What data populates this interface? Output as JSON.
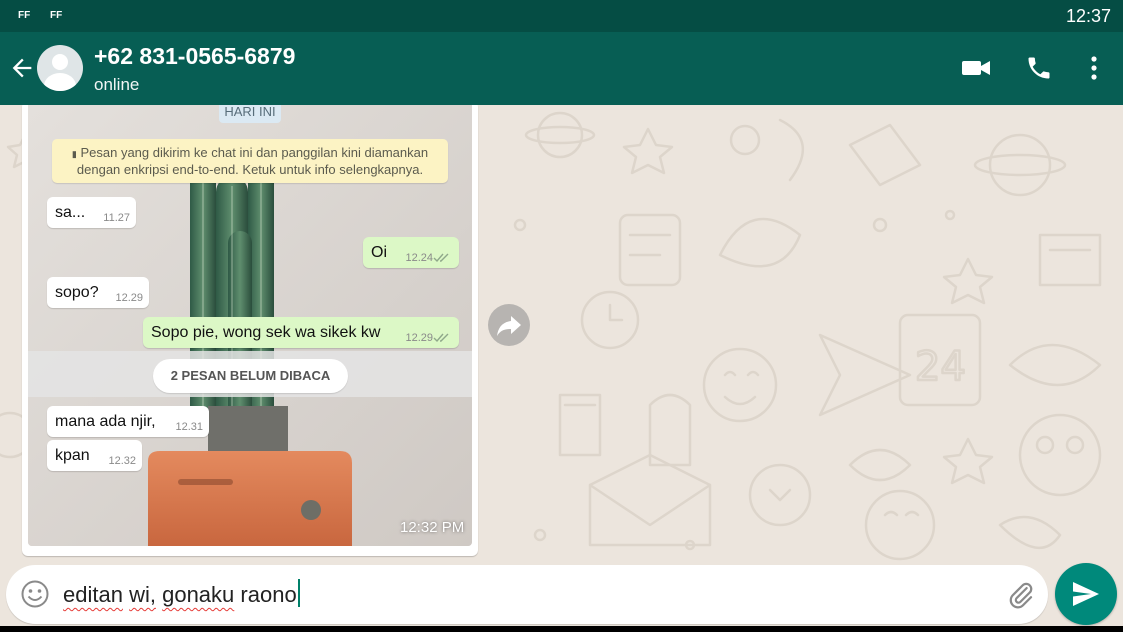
{
  "status_bar": {
    "left_icons": [
      "FF",
      "FF"
    ],
    "time": "12:37"
  },
  "header": {
    "contact_name": "+62 831-0565-6879",
    "contact_status": "online",
    "icons": [
      "back-arrow-icon",
      "avatar",
      "video-call-icon",
      "phone-icon",
      "more-vert-icon"
    ]
  },
  "screenshot_card": {
    "date_chip": "HARI INI",
    "encryption_notice": {
      "line1": "Pesan yang dikirim ke chat ini dan panggilan kini diamankan",
      "line2": "dengan enkripsi end-to-end. Ketuk untuk info selengkapnya."
    },
    "messages": [
      {
        "direction": "in",
        "text": "sa...",
        "time": "11.27"
      },
      {
        "direction": "out",
        "text": "Oi",
        "time": "12.24"
      },
      {
        "direction": "in",
        "text": "sopo?",
        "time": "12.29"
      },
      {
        "direction": "out",
        "text": "Sopo pie, wong sek wa sikek kw",
        "time": "12.29"
      },
      {
        "direction": "in",
        "text": "mana ada njir,",
        "time": "12.31"
      },
      {
        "direction": "in",
        "text": "kpan",
        "time": "12.32"
      }
    ],
    "unread_label": "2 PESAN BELUM DIBACA",
    "time": "12:32 PM"
  },
  "composer": {
    "words": [
      "editan",
      "wi,",
      "gonaku",
      "raono"
    ],
    "icons": [
      "emoji-icon",
      "attach-icon",
      "send-icon"
    ]
  },
  "colors": {
    "header": "#075e54",
    "status_bar": "#054d44",
    "outgoing_bubble": "#dcf8c6",
    "chat_background": "#ece5dd",
    "send_button": "#00897b"
  }
}
